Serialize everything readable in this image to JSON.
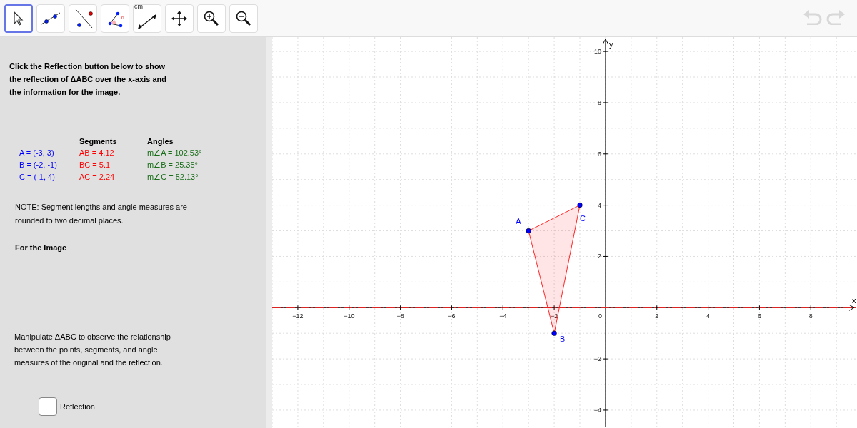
{
  "toolbar": {
    "tools": [
      {
        "kind": "move",
        "selected": true
      },
      {
        "kind": "line",
        "selected": false
      },
      {
        "kind": "perpendicular",
        "selected": false
      },
      {
        "kind": "angle",
        "selected": false,
        "label": "α"
      },
      {
        "kind": "distance",
        "selected": false,
        "label": "cm"
      },
      {
        "kind": "pan",
        "selected": false
      },
      {
        "kind": "zoom-in",
        "selected": false
      },
      {
        "kind": "zoom-out",
        "selected": false
      }
    ],
    "history": [
      {
        "kind": "undo",
        "disabled": true
      },
      {
        "kind": "redo",
        "disabled": true
      }
    ]
  },
  "panel": {
    "instructions": "Click the Reflection button below to show the reflection of ΔABC over the x-axis and the information for the image.",
    "table": {
      "headers": [
        "Segments",
        "Angles"
      ],
      "rows": [
        {
          "point": "A = (-3, 3)",
          "segment": "AB = 4.12",
          "angle": "m∠A = 102.53°"
        },
        {
          "point": "B = (-2, -1)",
          "segment": "BC = 5.1",
          "angle": "m∠B = 25.35°"
        },
        {
          "point": "C = (-1, 4)",
          "segment": "AC = 2.24",
          "angle": "m∠C = 52.13°"
        }
      ]
    },
    "note": "NOTE: Segment lengths and angle measures are rounded to two decimal places.",
    "image_heading": "For the Image",
    "manipulate": "Manipulate ΔABC to observe the relationship between the points, segments, and angle measures of the original and the reflection.",
    "checkbox": {
      "label": "Reflection",
      "checked": false
    }
  },
  "graph": {
    "chart_data": {
      "type": "scatter",
      "xlabel": "x",
      "ylabel": "y",
      "x": [
        -3,
        -2,
        -1
      ],
      "series": [
        {
          "color": "#0000ff",
          "values": [
            3,
            -1,
            4
          ]
        }
      ],
      "xlim": [
        -13,
        9.83
      ],
      "ylim": [
        -4.65,
        10.56
      ],
      "grid": true,
      "ref_lines": [
        {
          "axis": "y",
          "value": 0,
          "color": "#dd2222"
        }
      ],
      "xticks": [
        -12,
        -10,
        -8,
        -6,
        -4,
        -2,
        2,
        4,
        6,
        8
      ],
      "yticks": [
        -4,
        -2,
        2,
        4,
        6,
        8,
        10
      ],
      "annotations": [
        {
          "text": "A",
          "x": -3,
          "y": 3
        },
        {
          "text": "B",
          "x": -2,
          "y": -1
        },
        {
          "text": "C",
          "x": -1,
          "y": 4
        }
      ]
    },
    "origin_label": "0"
  }
}
